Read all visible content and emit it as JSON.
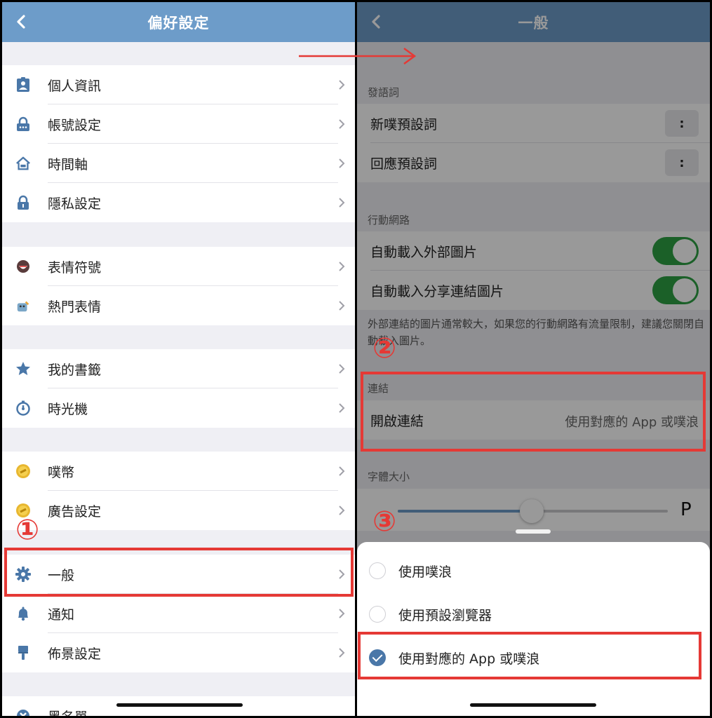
{
  "left": {
    "title": "偏好設定",
    "groups": [
      {
        "items": [
          {
            "label": "個人資訊",
            "icon": "id-card-icon"
          },
          {
            "label": "帳號設定",
            "icon": "account-lock-icon"
          },
          {
            "label": "時間軸",
            "icon": "home-icon"
          },
          {
            "label": "隱私設定",
            "icon": "lock-icon"
          }
        ]
      },
      {
        "items": [
          {
            "label": "表情符號",
            "icon": "emoji-icon"
          },
          {
            "label": "熱門表情",
            "icon": "hot-emoji-icon"
          }
        ]
      },
      {
        "items": [
          {
            "label": "我的書籤",
            "icon": "star-icon"
          },
          {
            "label": "時光機",
            "icon": "stopwatch-icon"
          }
        ]
      },
      {
        "items": [
          {
            "label": "噗幣",
            "icon": "coin-icon"
          },
          {
            "label": "廣告設定",
            "icon": "coin-icon"
          }
        ]
      },
      {
        "items": [
          {
            "label": "一般",
            "icon": "gear-icon"
          },
          {
            "label": "通知",
            "icon": "bell-icon"
          },
          {
            "label": "佈景設定",
            "icon": "brush-icon"
          }
        ]
      },
      {
        "items": [
          {
            "label": "黑名單",
            "icon": "block-icon"
          }
        ]
      }
    ]
  },
  "right": {
    "title": "一般",
    "sections": {
      "phrase_header": "發語詞",
      "new_plurk_phrase": "新噗預設詞",
      "reply_phrase": "回應預設詞",
      "phrase_button": ":",
      "mobile_header": "行動網路",
      "auto_external": "自動載入外部圖片",
      "auto_share": "自動載入分享連結圖片",
      "mobile_note": "外部連結的圖片通常較大，如果您的行動網路有流量限制，建議您關閉自動載入圖片。",
      "link_header": "連結",
      "open_link": "開啟連結",
      "open_link_value": "使用對應的 App 或噗浪",
      "font_header": "字體大小",
      "font_letter": "P"
    },
    "options": [
      {
        "label": "使用噗浪",
        "checked": false
      },
      {
        "label": "使用預設瀏覽器",
        "checked": false
      },
      {
        "label": "使用對應的 App 或噗浪",
        "checked": true
      }
    ]
  },
  "annotations": [
    "1",
    "2",
    "3"
  ],
  "colors": {
    "navbar": "#6d9cc9",
    "accent": "#4a77a8",
    "toggle_on": "#2ea043",
    "highlight": "#e53935"
  }
}
